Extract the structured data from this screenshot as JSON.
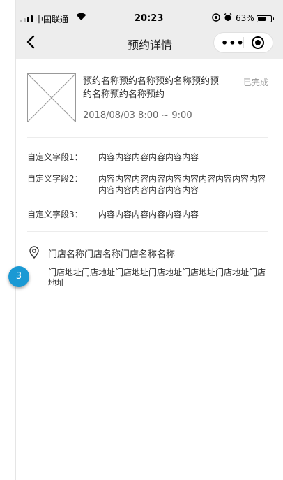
{
  "status_bar": {
    "carrier": "中国联通",
    "time": "20:23",
    "battery_percent": "63%",
    "battery_level": 0.63
  },
  "navbar": {
    "title": "预约详情",
    "more_label": "•••"
  },
  "order": {
    "name": "预约名称预约名称预约名称预约预约名称预约名称预约",
    "status": "已完成",
    "time": "2018/08/03 8:00 ~ 9:00"
  },
  "custom_fields": [
    {
      "label": "自定义字段1：",
      "value": "内容内容内容内容内容内容"
    },
    {
      "label": "自定义字段2：",
      "value": "内容内容内容内容内容内容内容内容内容内容内容内容内容内容内容内容"
    },
    {
      "label": "自定义字段3：",
      "value": "内容内容内容内容内容内容"
    }
  ],
  "store": {
    "name": "门店名称门店名称门店名称名称",
    "address": "门店地址门店地址门店地址门店地址门店地址门店地址门店地址"
  },
  "step_badge": "3",
  "colors": {
    "accent": "#1a99d4",
    "muted": "#999999",
    "nav_bg": "#ededed"
  }
}
